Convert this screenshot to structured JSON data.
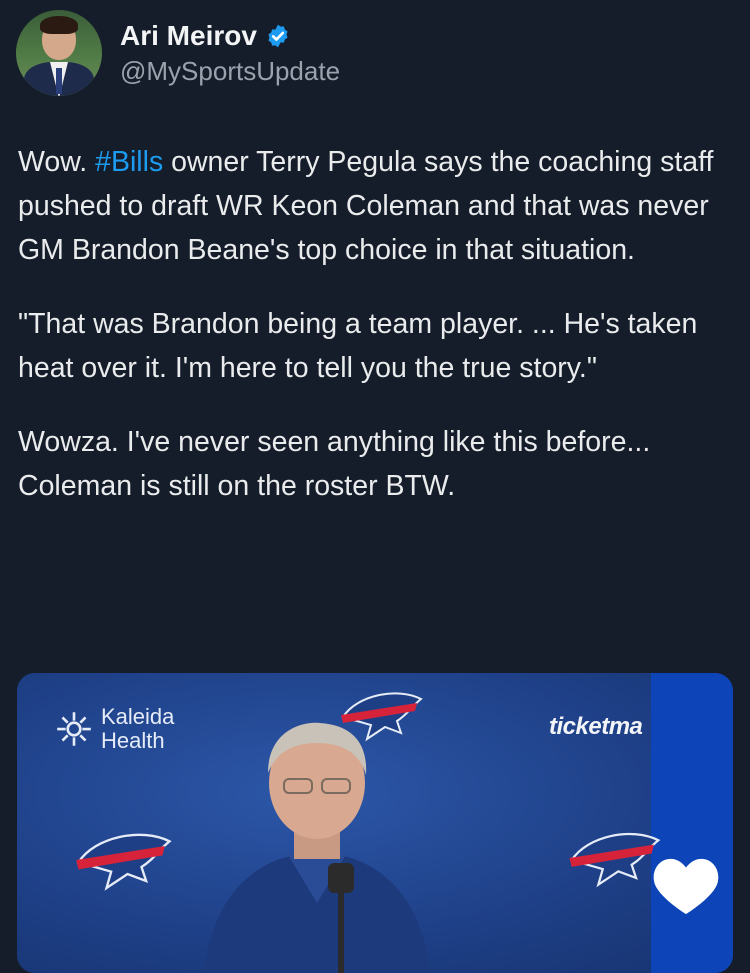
{
  "author": {
    "name": "Ari Meirov",
    "handle": "@MySportsUpdate",
    "verified": true
  },
  "tweet": {
    "p1_prefix": "Wow. ",
    "hashtag": "#Bills",
    "p1_suffix": " owner Terry Pegula says the coaching staff pushed to draft WR Keon Coleman and that was never GM Brandon Beane's top choice in that situation.",
    "p2": "\"That was Brandon being a team player. ... He's taken heat over it. I'm here to tell you the true story.\"",
    "p3": "Wowza. I've never seen anything like this before... Coleman is still on the roster BTW."
  },
  "media": {
    "sponsor_line1": "Kaleida",
    "sponsor_line2": "Health",
    "ticket_text": "ticketma"
  },
  "icons": {
    "verified": "verified-badge-icon",
    "like": "heart-icon"
  },
  "colors": {
    "background": "#151d2a",
    "hashtag": "#1d9bf0",
    "verified": "#1d9bf0"
  }
}
